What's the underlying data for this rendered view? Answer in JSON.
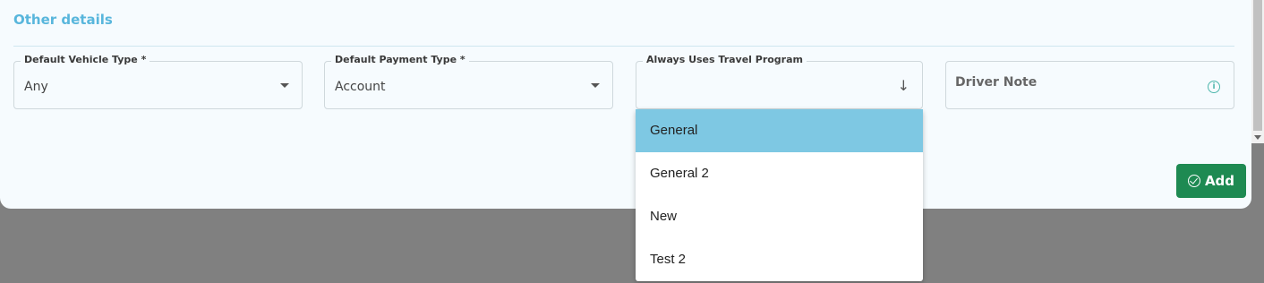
{
  "section": {
    "title": "Other details"
  },
  "fields": {
    "vehicle_type": {
      "label": "Default Vehicle Type *",
      "value": "Any"
    },
    "payment_type": {
      "label": "Default Payment Type *",
      "value": "Account"
    },
    "travel_program": {
      "label": "Always Uses Travel Program",
      "value": ""
    },
    "driver_note": {
      "placeholder": "Driver Note"
    }
  },
  "dropdown": {
    "options": [
      "General",
      "General 2",
      "New",
      "Test 2"
    ],
    "selected": "General"
  },
  "actions": {
    "add_label": "Add"
  },
  "icons": {
    "caret": "chevron-down-icon",
    "arrow": "arrow-down-icon",
    "info": "info-icon",
    "check": "check-circle-icon"
  },
  "colors": {
    "accent": "#58b6dc",
    "selected_option": "#7ec8e3",
    "add_button": "#1e8a52"
  }
}
